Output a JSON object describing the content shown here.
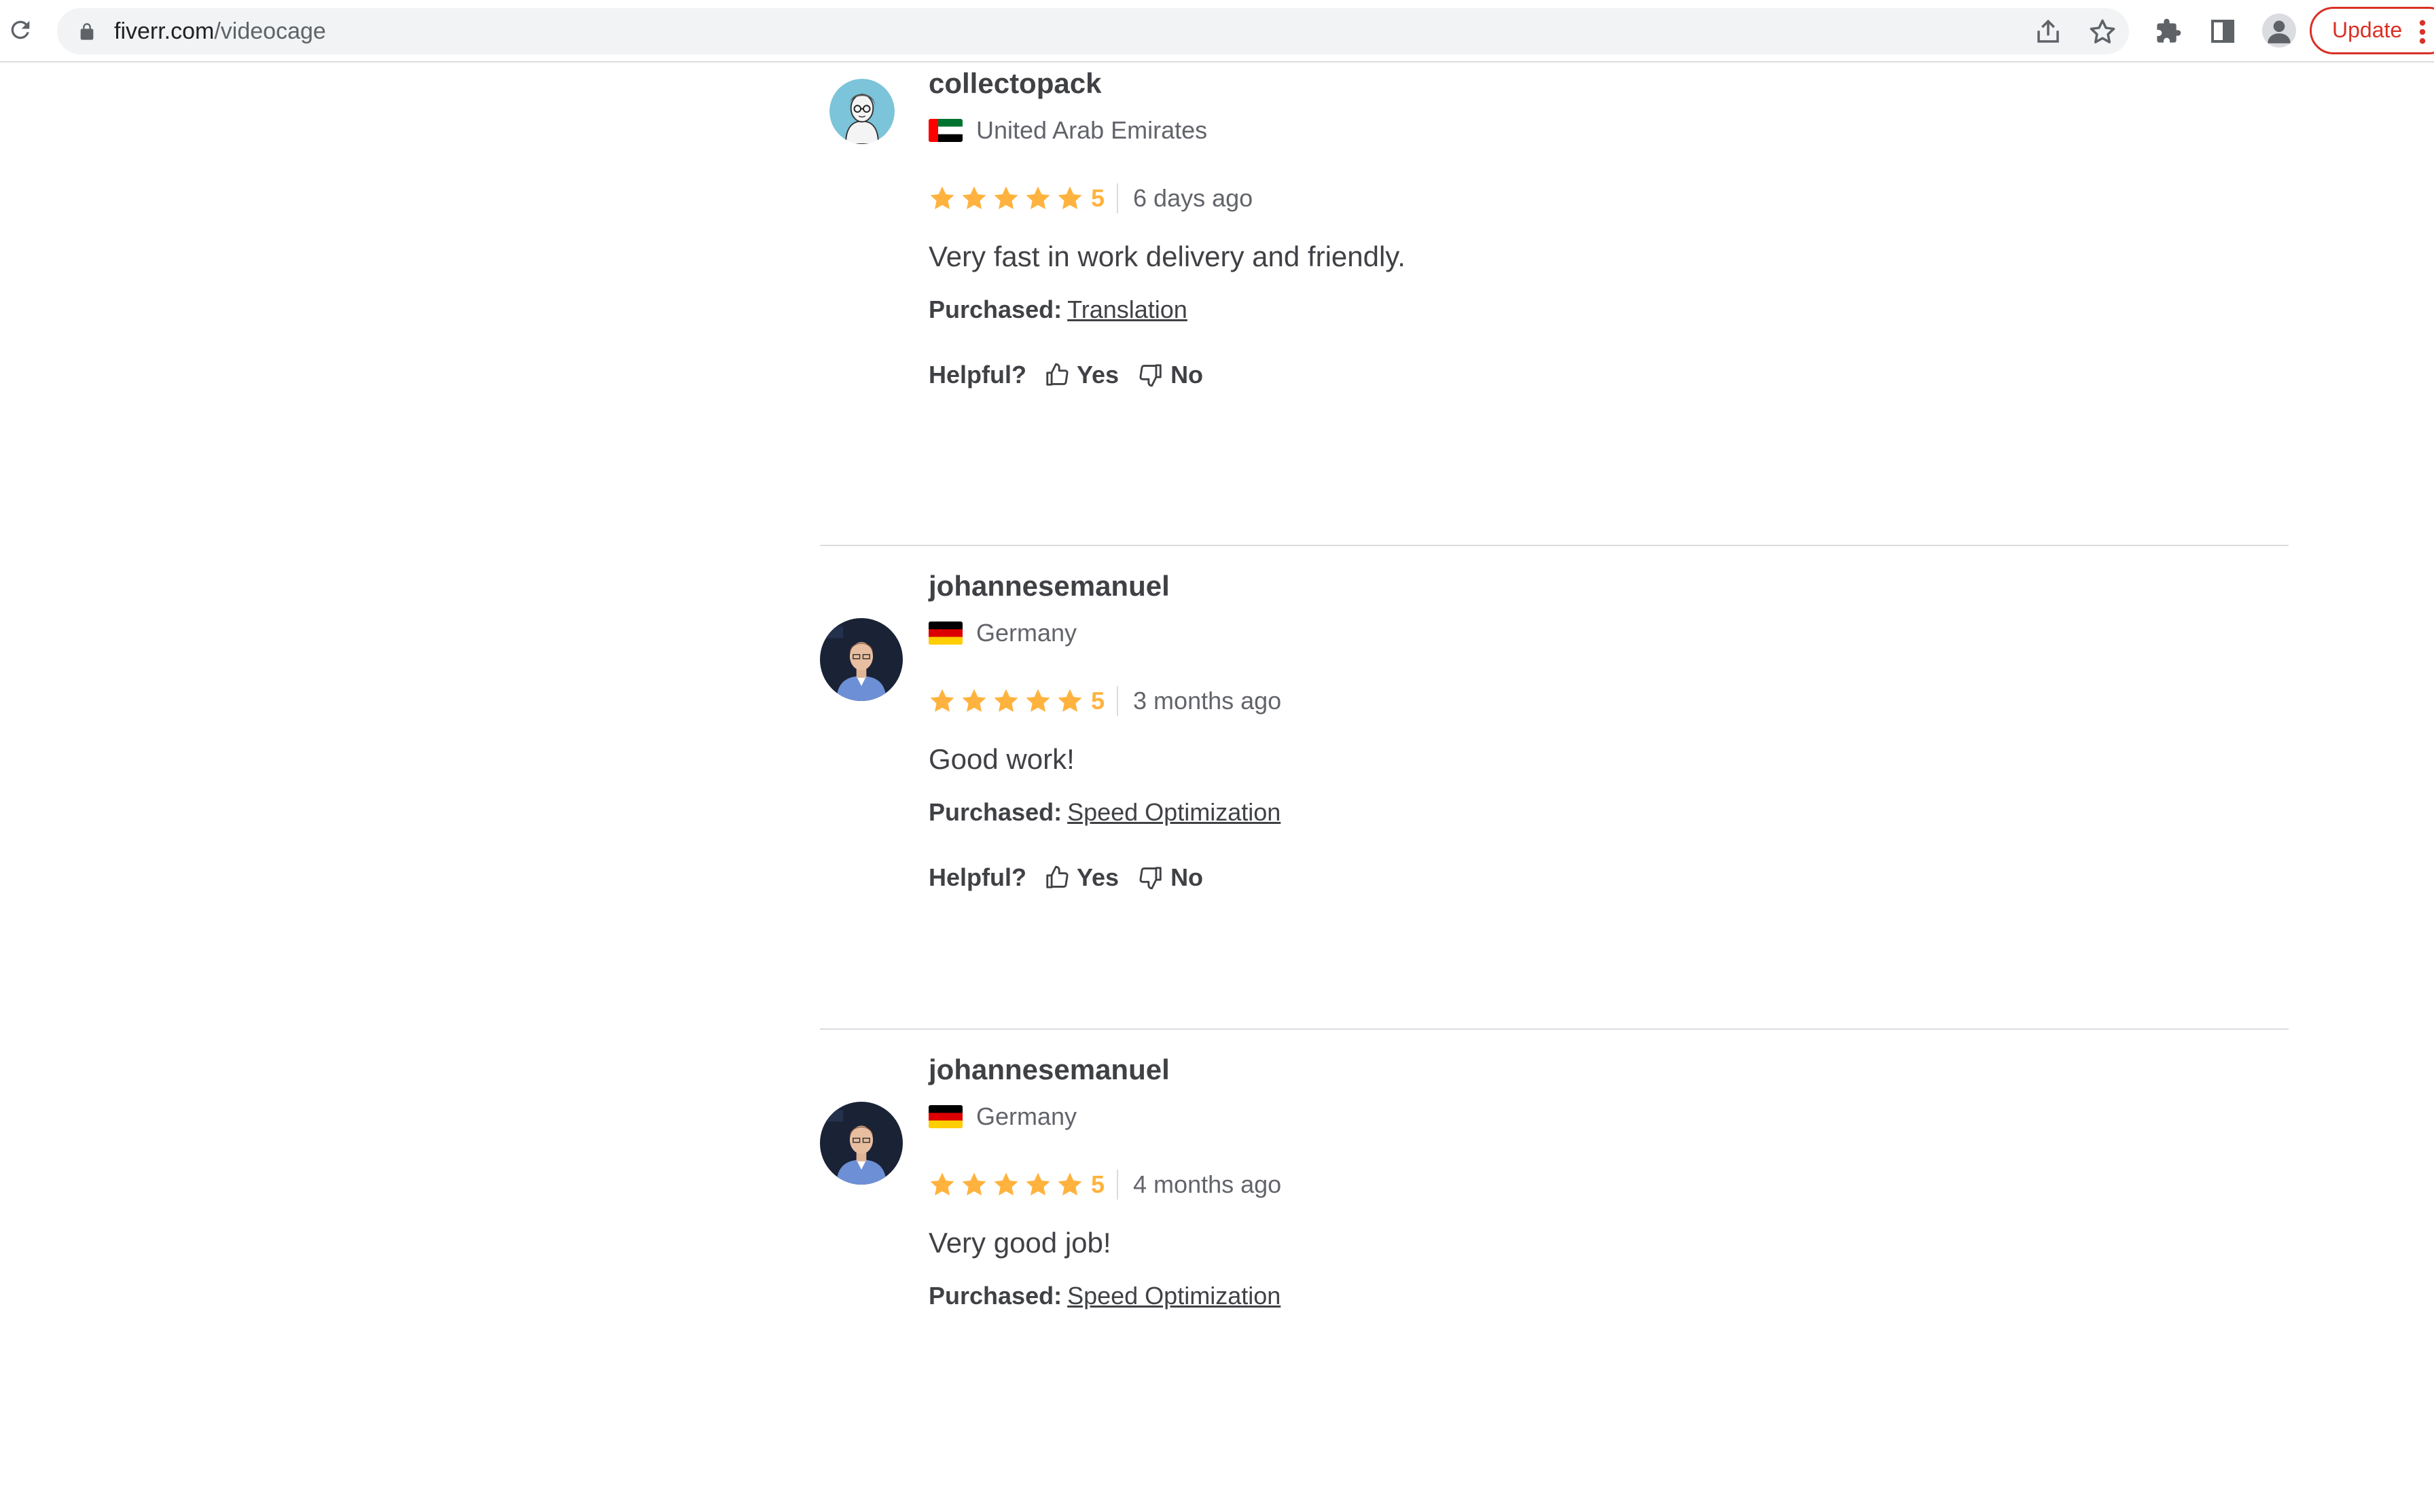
{
  "browser": {
    "url_host": "fiverr.com",
    "url_path": "/videocage",
    "update_label": "Update"
  },
  "colors": {
    "star": "#ffb33e",
    "update_red": "#d93025",
    "text": "#404145",
    "muted": "#62646a"
  },
  "reviews": [
    {
      "username": "collectopack",
      "country": "United Arab Emirates",
      "flag_icon": "uae-flag-icon",
      "rating": "5",
      "time": "6 days ago",
      "text": "Very fast in work delivery and friendly.",
      "purchased_label": "Purchased:",
      "purchased_item": "Translation",
      "helpful_label": "Helpful?",
      "yes_label": "Yes",
      "no_label": "No"
    },
    {
      "username": "johannesemanuel",
      "country": "Germany",
      "flag_icon": "germany-flag-icon",
      "rating": "5",
      "time": "3 months ago",
      "text": "Good work!",
      "purchased_label": "Purchased:",
      "purchased_item": "Speed Optimization",
      "helpful_label": "Helpful?",
      "yes_label": "Yes",
      "no_label": "No"
    },
    {
      "username": "johannesemanuel",
      "country": "Germany",
      "flag_icon": "germany-flag-icon",
      "rating": "5",
      "time": "4 months ago",
      "text": "Very good job!",
      "purchased_label": "Purchased:",
      "purchased_item": "Speed Optimization"
    }
  ]
}
